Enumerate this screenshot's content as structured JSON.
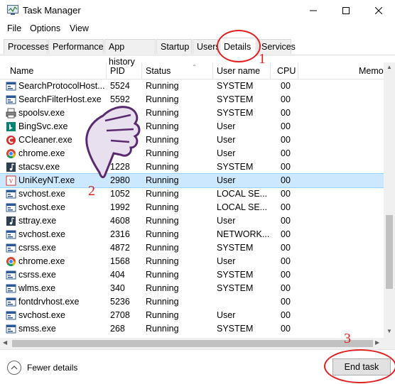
{
  "window": {
    "title": "Task Manager"
  },
  "menu": [
    "File",
    "Options",
    "View"
  ],
  "tabs": [
    "Processes",
    "Performance",
    "App history",
    "Startup",
    "Users",
    "Details",
    "Services"
  ],
  "active_tab": "Details",
  "columns": [
    "Name",
    "PID",
    "Status",
    "User name",
    "CPU",
    "Memo"
  ],
  "rows": [
    {
      "name": "SearchProtocolHost....",
      "pid": "5524",
      "status": "Running",
      "user": "SYSTEM",
      "cpu": "00",
      "icon": "process-icon"
    },
    {
      "name": "SearchFilterHost.exe",
      "pid": "5592",
      "status": "Running",
      "user": "SYSTEM",
      "cpu": "00",
      "icon": "process-icon"
    },
    {
      "name": "spoolsv.exe",
      "pid": "",
      "status": "Running",
      "user": "SYSTEM",
      "cpu": "00",
      "icon": "printer-icon"
    },
    {
      "name": "BingSvc.exe",
      "pid": "",
      "status": "Running",
      "user": "User",
      "cpu": "00",
      "icon": "bing-icon"
    },
    {
      "name": "CCleaner.exe",
      "pid": "",
      "status": "Running",
      "user": "User",
      "cpu": "00",
      "icon": "ccleaner-icon"
    },
    {
      "name": "chrome.exe",
      "pid": "",
      "status": "Running",
      "user": "User",
      "cpu": "00",
      "icon": "chrome-icon"
    },
    {
      "name": "stacsv.exe",
      "pid": "1228",
      "status": "Running",
      "user": "SYSTEM",
      "cpu": "00",
      "icon": "audio-icon"
    },
    {
      "name": "UniKeyNT.exe",
      "pid": "2980",
      "status": "Running",
      "user": "User",
      "cpu": "00",
      "icon": "unikey-icon"
    },
    {
      "name": "svchost.exe",
      "pid": "1052",
      "status": "Running",
      "user": "LOCAL SE...",
      "cpu": "00",
      "icon": "process-icon"
    },
    {
      "name": "svchost.exe",
      "pid": "1992",
      "status": "Running",
      "user": "LOCAL SE...",
      "cpu": "00",
      "icon": "process-icon"
    },
    {
      "name": "sttray.exe",
      "pid": "4608",
      "status": "Running",
      "user": "User",
      "cpu": "00",
      "icon": "audio-icon"
    },
    {
      "name": "svchost.exe",
      "pid": "2316",
      "status": "Running",
      "user": "NETWORK...",
      "cpu": "00",
      "icon": "process-icon"
    },
    {
      "name": "csrss.exe",
      "pid": "4872",
      "status": "Running",
      "user": "SYSTEM",
      "cpu": "00",
      "icon": "process-icon"
    },
    {
      "name": "chrome.exe",
      "pid": "1568",
      "status": "Running",
      "user": "User",
      "cpu": "00",
      "icon": "chrome-icon"
    },
    {
      "name": "csrss.exe",
      "pid": "404",
      "status": "Running",
      "user": "SYSTEM",
      "cpu": "00",
      "icon": "process-icon"
    },
    {
      "name": "wlms.exe",
      "pid": "340",
      "status": "Running",
      "user": "SYSTEM",
      "cpu": "00",
      "icon": "process-icon"
    },
    {
      "name": "fontdrvhost.exe",
      "pid": "5236",
      "status": "Running",
      "user": "",
      "cpu": "00",
      "icon": "process-icon"
    },
    {
      "name": "svchost.exe",
      "pid": "2708",
      "status": "Running",
      "user": "User",
      "cpu": "00",
      "icon": "process-icon"
    },
    {
      "name": "smss.exe",
      "pid": "268",
      "status": "Running",
      "user": "SYSTEM",
      "cpu": "00",
      "icon": "process-icon"
    }
  ],
  "selected_row": 7,
  "footer": {
    "fewer_details": "Fewer details",
    "end_task": "End task"
  },
  "annotations": [
    "1",
    "2",
    "3"
  ],
  "colors": {
    "selection": "#cce8ff",
    "annotation": "#e02020"
  }
}
